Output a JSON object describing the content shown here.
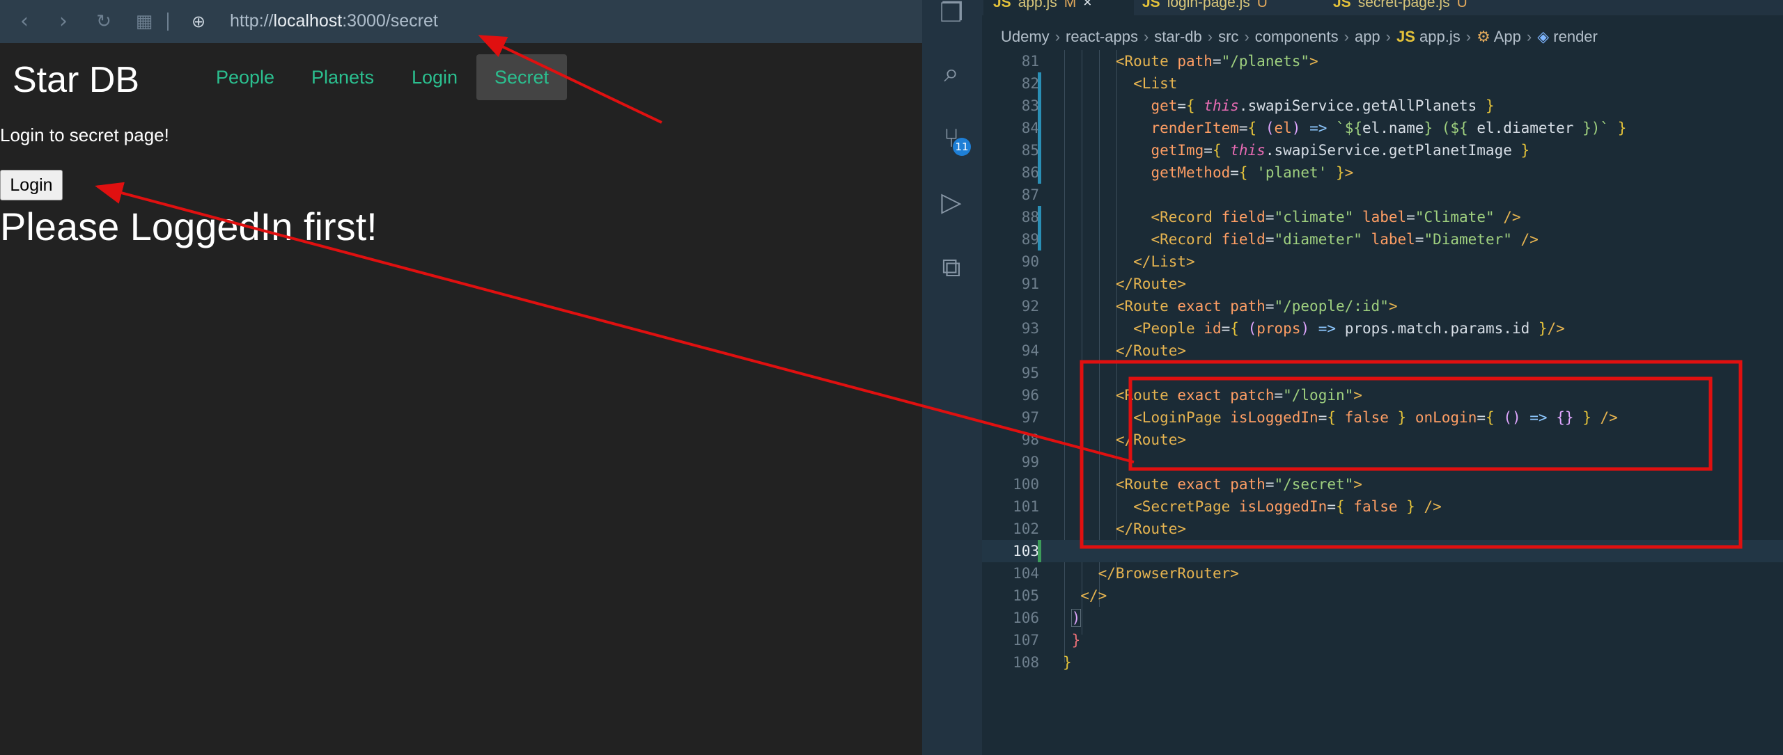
{
  "browser": {
    "url_scheme": "http://",
    "url_host": "localhost",
    "url_rest": ":3000/secret",
    "brand": "Star DB",
    "nav": [
      "People",
      "Planets",
      "Login",
      "Secret"
    ],
    "lead": "Login to secret page!",
    "login_button": "Login",
    "warning": "Please LoggedIn first!",
    "icons": [
      "back-icon",
      "forward-icon",
      "reload-icon",
      "grid-icon",
      "globe-icon"
    ]
  },
  "editor": {
    "tabs": [
      {
        "label": "app.js",
        "status": "M",
        "close": "×"
      },
      {
        "label": "login-page.js",
        "status": "U"
      },
      {
        "label": "secret-page.js",
        "status": "U"
      }
    ],
    "tab_prefix": "JS",
    "breadcrumbs": [
      "Udemy",
      "react-apps",
      "star-db",
      "src",
      "components",
      "app",
      "app.js",
      "App",
      "render"
    ],
    "scm_badge": "11",
    "line_numbers": [
      "81",
      "82",
      "83",
      "84",
      "85",
      "86",
      "87",
      "88",
      "89",
      "90",
      "91",
      "92",
      "93",
      "94",
      "95",
      "96",
      "97",
      "98",
      "99",
      "100",
      "101",
      "102",
      "103",
      "104",
      "105",
      "106",
      "107",
      "108"
    ]
  },
  "colors": {
    "annotation": "#e01010",
    "nav_link": "#2bbf8f",
    "editor_bg": "#1b2b36"
  }
}
